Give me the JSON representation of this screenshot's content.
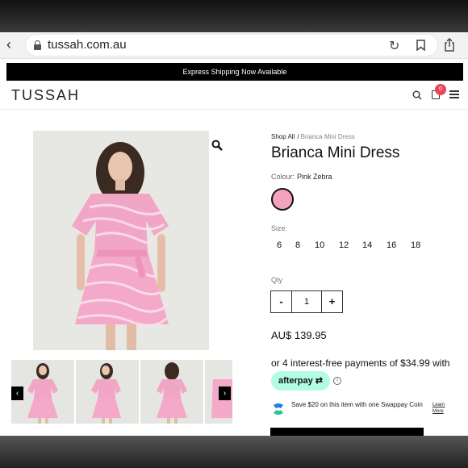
{
  "browser": {
    "url": "tussah.com.au",
    "back_icon": "chevron-left-icon",
    "reload_icon": "reload-icon",
    "bookmark_icon": "bookmark-icon",
    "share_icon": "share-icon"
  },
  "promo": {
    "text": "Express Shipping Now Available"
  },
  "header": {
    "logo": "TUSSAH",
    "cart_count": "0",
    "badge_color": "#e8465a"
  },
  "breadcrumb": {
    "home": "Shop All",
    "separator": "/",
    "current": "Brianca Mini Dress"
  },
  "product": {
    "title": "Brianca Mini Dress",
    "colour_label": "Colour:",
    "colour_value": "Pink Zebra",
    "swatch_color": "#f5a2c0",
    "size_label": "Size:",
    "sizes": [
      "6",
      "8",
      "10",
      "12",
      "14",
      "16",
      "18"
    ],
    "qty_label": "Qty",
    "qty_minus": "-",
    "qty_value": "1",
    "qty_plus": "+",
    "price": "AU$ 139.95"
  },
  "payments": {
    "installments_text": "or 4 interest-free payments of $34.99 with",
    "afterpay_label": "afterpay",
    "afterpay_color": "#b2fce4",
    "info_symbol": "i",
    "swappay_text": "Save $20 on this item with one Swappay Coin",
    "learn_more": "Learn More"
  },
  "gallery": {
    "prev": "‹",
    "next": "›",
    "thumbnail_count": 4
  }
}
